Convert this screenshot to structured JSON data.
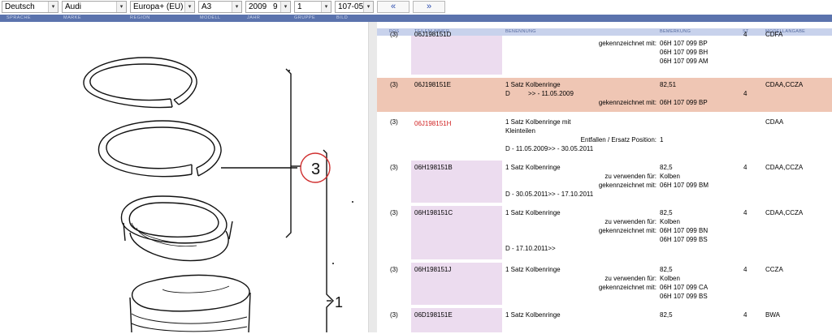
{
  "toolbar": {
    "language": "Deutsch",
    "brand": "Audi",
    "region": "Europa+ (EU)",
    "model": "A3",
    "year": "2009",
    "year_sub": "9",
    "group": "1",
    "image": "107-05",
    "prev_label": "«",
    "next_label": "»",
    "arrow_glyph": "▾"
  },
  "labels": {
    "sprache": "SPRACHE",
    "marke": "MARKE",
    "region": "REGION",
    "modell": "MODELL",
    "jahr": "JAHR",
    "gruppe": "GRUPPE",
    "bild": "BILD"
  },
  "table": {
    "headers": {
      "pos": "POS",
      "teilenummer": "TEILENUMMER",
      "benennung": "BENENNUNG",
      "bemerkung": "BEMERKUNG",
      "st": "ST",
      "modellangabe": "MODELLANGABE"
    },
    "partial_row": {
      "pos": "(3)",
      "part": "06J198151D",
      "remark_label": "gekennzeichnet mit:",
      "remark_values": [
        "06H 107 099 BP",
        "06H 107 099 BH",
        "06H 107 099 AM"
      ],
      "qty": "4",
      "model": "CDFA"
    },
    "rows": [
      {
        "pos": "(3)",
        "part": "06J198151E",
        "name": "1 Satz Kolbenringe",
        "line2": "D          >> - 11.05.2009",
        "remark1": "82,51",
        "label_a": "gekennzeichnet mit:",
        "value_a": "06H 107 099 BP",
        "qty": "4",
        "model": "CDAA,CCZA"
      },
      {
        "pos": "(3)",
        "part": "06J198151H",
        "name": "1 Satz Kolbenringe mit",
        "name2": "Kleinteilen",
        "label_a": "Entfallen / Ersatz Position:",
        "value_a": "1",
        "line_dates": "D - 11.05.2009>> - 30.05.2011",
        "model": "CDAA"
      },
      {
        "pos": "(3)",
        "part": "06H198151B",
        "name": "1 Satz Kolbenringe",
        "remark1": "82,5",
        "label_a": "zu verwenden für:",
        "value_a": "Kolben",
        "label_b": "gekennzeichnet mit:",
        "value_b": "06H 107 099 BM",
        "line_dates": "D - 30.05.2011>> - 17.10.2011",
        "qty": "4",
        "model": "CDAA,CCZA"
      },
      {
        "pos": "(3)",
        "part": "06H198151C",
        "name": "1 Satz Kolbenringe",
        "remark1": "82,5",
        "label_a": "zu verwenden für:",
        "value_a": "Kolben",
        "label_b": "gekennzeichnet mit:",
        "value_b": "06H 107 099 BN",
        "value_c": "06H 107 099 BS",
        "line_dates": "D - 17.10.2011>>",
        "qty": "4",
        "model": "CDAA,CCZA"
      },
      {
        "pos": "(3)",
        "part": "06H198151J",
        "name": "1 Satz Kolbenringe",
        "remark1": "82,5",
        "label_a": "zu verwenden für:",
        "value_a": "Kolben",
        "label_b": "gekennzeichnet mit:",
        "value_b": "06H 107 099 CA",
        "value_c": "06H 107 099 BS",
        "qty": "4",
        "model": "CCZA"
      },
      {
        "pos": "(3)",
        "part": "06D198151E",
        "name": "1 Satz Kolbenringe",
        "remark1": "82,5",
        "qty": "4",
        "model": "BWA"
      }
    ]
  },
  "diagram": {
    "callout_3": "3",
    "callout_1": "1"
  },
  "colors": {
    "label_bar": "#5b73ad",
    "header_bg": "#c8d2ec",
    "highlight_row": "#efc6b4",
    "part_cell": "#ecdcef",
    "red_part": "#d02020",
    "callout_circle": "#d03030"
  }
}
